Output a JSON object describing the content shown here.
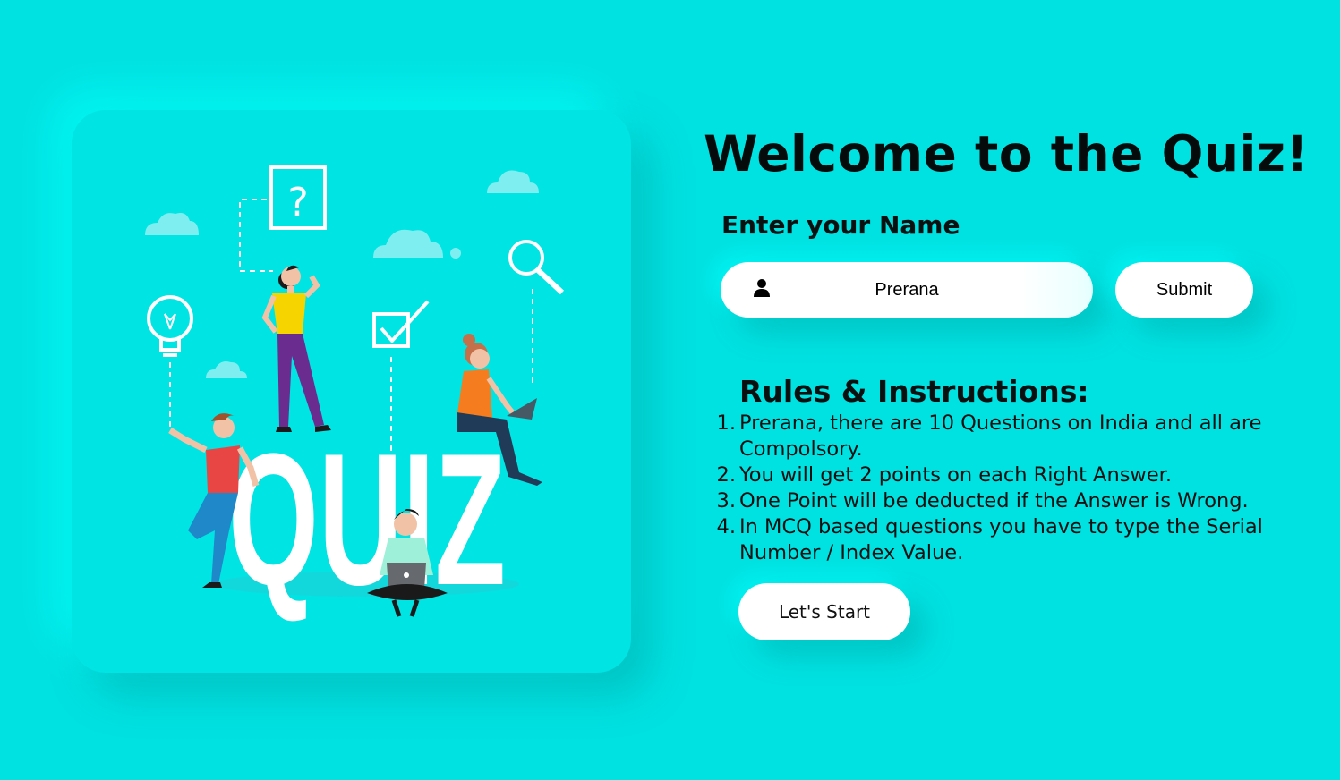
{
  "page": {
    "background_color": "#00e1e1",
    "accent_white": "#ffffff"
  },
  "illustration": {
    "word": "QUIZ",
    "icons": [
      "question-mark-icon",
      "lightbulb-icon",
      "checkbox-icon",
      "magnifier-icon",
      "cloud-icon"
    ]
  },
  "header": {
    "title": "Welcome to the Quiz!"
  },
  "name_form": {
    "label": "Enter your Name",
    "icon": "user-icon",
    "value": "Prerana",
    "submit_label": "Submit"
  },
  "rules": {
    "heading": "Rules & Instructions:",
    "items": [
      {
        "num": "1.",
        "text": "Prerana, there are 10 Questions on India and all are Compolsory."
      },
      {
        "num": "2.",
        "text": "You will get 2 points on each Right Answer."
      },
      {
        "num": "3.",
        "text": "One Point will be deducted if the Answer is Wrong."
      },
      {
        "num": "4.",
        "text": "In MCQ based questions you have to type the Serial Number / Index Value."
      }
    ]
  },
  "start_button": {
    "label": "Let's Start"
  }
}
